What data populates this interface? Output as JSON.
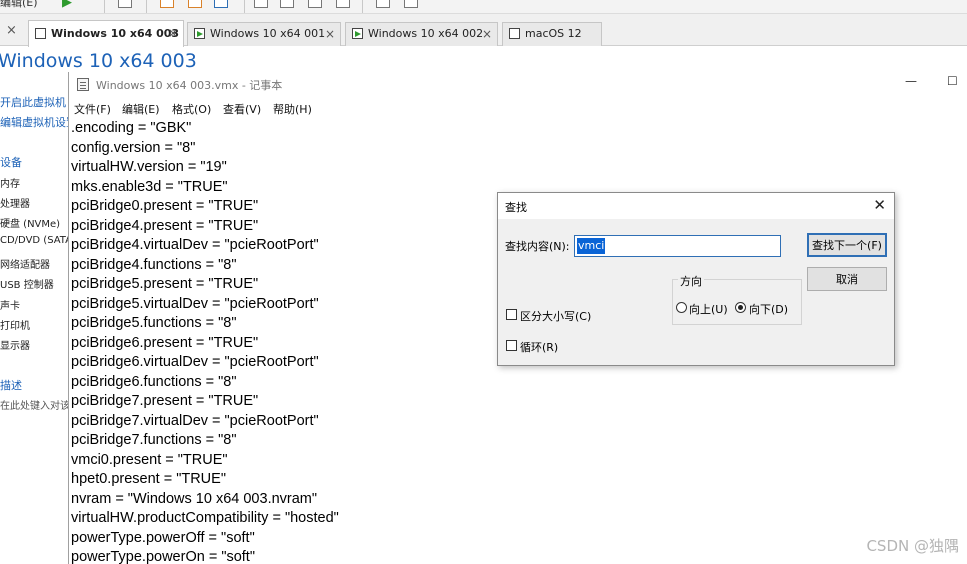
{
  "host": {
    "menu_label": "编辑(E)",
    "tabs": [
      {
        "label": "Windows 10 x64 003",
        "active": true
      },
      {
        "label": "Windows 10 x64 001",
        "active": false
      },
      {
        "label": "Windows 10 x64 002",
        "active": false
      },
      {
        "label": "macOS 12",
        "active": false
      }
    ],
    "close_glyph": "×",
    "vm_title": "Windows 10 x64 003",
    "vm_commands": [
      "开启此虚拟机",
      "编辑虚拟机设置"
    ],
    "devices_heading": "设备",
    "devices": [
      "内存",
      "处理器",
      "硬盘 (NVMe)",
      "CD/DVD (SATA)",
      "网络适配器",
      "USB 控制器",
      "声卡",
      "打印机",
      "显示器"
    ],
    "description_heading": "描述",
    "description_placeholder": "在此处键入对该虚拟机的描述。"
  },
  "notepad": {
    "title": "Windows 10 x64 003.vmx - 记事本",
    "minimize_glyph": "—",
    "maximize_glyph": "☐",
    "menu": [
      "文件(F)",
      "编辑(E)",
      "格式(O)",
      "查看(V)",
      "帮助(H)"
    ],
    "lines": [
      ".encoding = \"GBK\"",
      "config.version = \"8\"",
      "virtualHW.version = \"19\"",
      "mks.enable3d = \"TRUE\"",
      "pciBridge0.present = \"TRUE\"",
      "pciBridge4.present = \"TRUE\"",
      "pciBridge4.virtualDev = \"pcieRootPort\"",
      "pciBridge4.functions = \"8\"",
      "pciBridge5.present = \"TRUE\"",
      "pciBridge5.virtualDev = \"pcieRootPort\"",
      "pciBridge5.functions = \"8\"",
      "pciBridge6.present = \"TRUE\"",
      "pciBridge6.virtualDev = \"pcieRootPort\"",
      "pciBridge6.functions = \"8\"",
      "pciBridge7.present = \"TRUE\"",
      "pciBridge7.virtualDev = \"pcieRootPort\"",
      "pciBridge7.functions = \"8\"",
      "vmci0.present = \"TRUE\"",
      "hpet0.present = \"TRUE\"",
      "nvram = \"Windows 10 x64 003.nvram\"",
      "virtualHW.productCompatibility = \"hosted\"",
      "powerType.powerOff = \"soft\"",
      "powerType.powerOn = \"soft\""
    ]
  },
  "find_dialog": {
    "title": "查找",
    "close_glyph": "✕",
    "find_label": "查找内容(N):",
    "find_value": "vmci",
    "find_next_label": "查找下一个(F)",
    "cancel_label": "取消",
    "direction_label": "方向",
    "direction_up_label": "向上(U)",
    "direction_down_label": "向下(D)",
    "direction_selected": "down",
    "match_case_label": "区分大小写(C)",
    "match_case_checked": false,
    "wrap_label": "循环(R)",
    "wrap_checked": false
  },
  "watermark": "CSDN @独隅"
}
